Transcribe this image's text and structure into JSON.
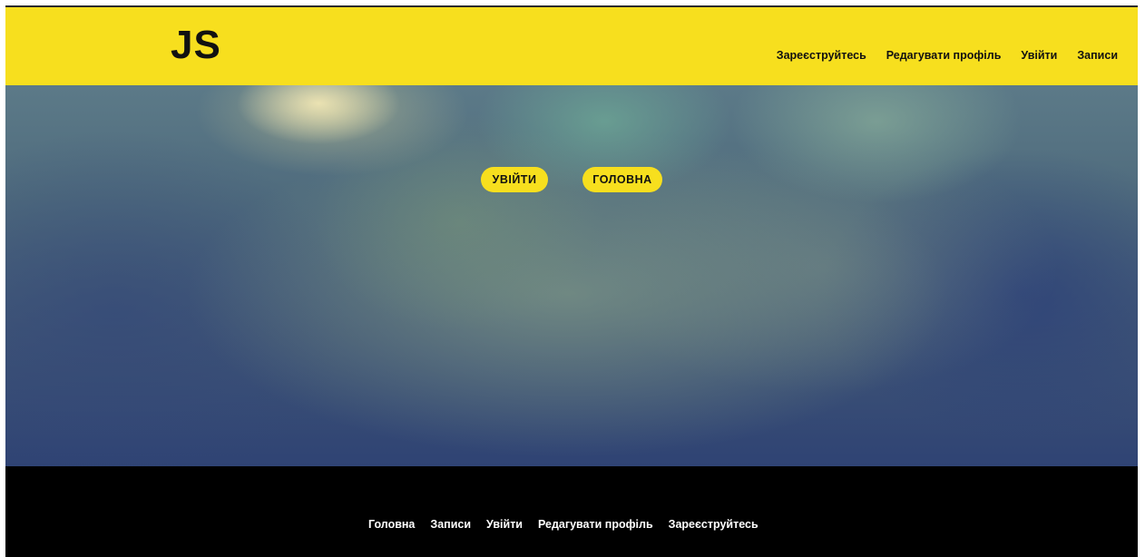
{
  "header": {
    "logo": "JS",
    "nav": [
      "Зареєструйтесь",
      "Редагувати профіль",
      "Увійти",
      "Записи"
    ]
  },
  "hero": {
    "buttons": [
      "УВІЙТИ",
      "ГОЛОВНА"
    ]
  },
  "footer": {
    "nav": [
      "Головна",
      "Записи",
      "Увійти",
      "Редагувати профіль",
      "Зареєструйтесь"
    ]
  },
  "colors": {
    "brand_yellow": "#f7df1e",
    "footer_bg": "#000000",
    "text_dark": "#111111",
    "footer_text": "#ffffff"
  }
}
